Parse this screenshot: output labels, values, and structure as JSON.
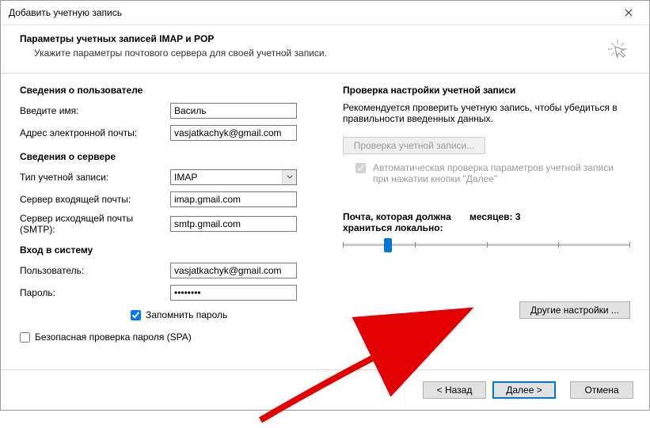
{
  "window": {
    "title": "Добавить учетную запись"
  },
  "header": {
    "title": "Параметры учетных записей IMAP и POP",
    "subtitle": "Укажите параметры почтового сервера для своей учетной записи."
  },
  "left": {
    "user_section": "Сведения о пользователе",
    "name_label": "Введите имя:",
    "name_value": "Василь",
    "email_label": "Адрес электронной почты:",
    "email_value": "vasjatkachyk@gmail.com",
    "server_section": "Сведения о сервере",
    "type_label": "Тип учетной записи:",
    "type_value": "IMAP",
    "incoming_label": "Сервер входящей почты:",
    "incoming_value": "imap.gmail.com",
    "outgoing_label": "Сервер исходящей почты (SMTP):",
    "outgoing_value": "smtp.gmail.com",
    "login_section": "Вход в систему",
    "user_label": "Пользователь:",
    "user_value": "vasjatkachyk@gmail.com",
    "pass_label": "Пароль:",
    "pass_value": "********",
    "remember": "Запомнить пароль",
    "spa": "Безопасная проверка пароля (SPA)"
  },
  "right": {
    "test_section": "Проверка настройки учетной записи",
    "test_desc": "Рекомендуется проверить учетную запись, чтобы убедиться в правильности введенных данных.",
    "test_btn": "Проверка учетной записи...",
    "auto_test": "Автоматическая проверка параметров учетной записи при нажатии кнопки \"Далее\"",
    "mail_keep_label": "Почта, которая должна храниться локально:",
    "months_label": "месяцев: 3",
    "other_btn": "Другие настройки ..."
  },
  "footer": {
    "back": "< Назад",
    "next": "Далее >",
    "cancel": "Отмена"
  }
}
